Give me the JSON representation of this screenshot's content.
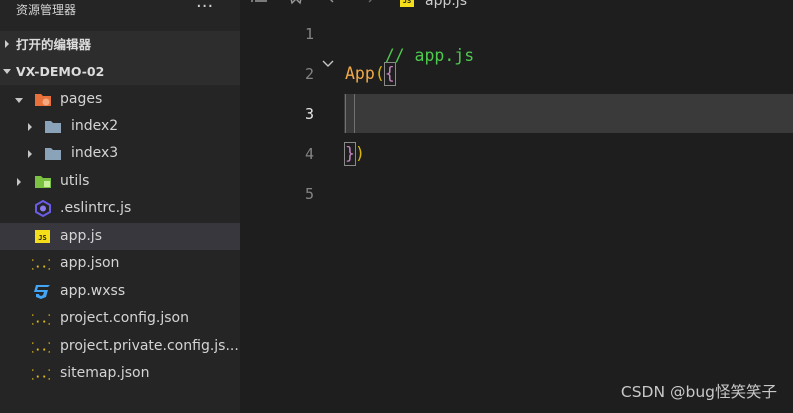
{
  "sidebar": {
    "title": "资源管理器",
    "more_label": "···",
    "sections": [
      {
        "label": "打开的编辑器"
      },
      {
        "label": "VX-DEMO-02"
      }
    ],
    "items": [
      {
        "label": "pages",
        "icon": "folder-pages-icon"
      },
      {
        "label": "index2",
        "icon": "folder-icon"
      },
      {
        "label": "index3",
        "icon": "folder-icon"
      },
      {
        "label": "utils",
        "icon": "folder-utils-icon"
      },
      {
        "label": ".eslintrc.js",
        "icon": "eslint-icon"
      },
      {
        "label": "app.js",
        "icon": "javascript-icon"
      },
      {
        "label": "app.json",
        "icon": "json-icon"
      },
      {
        "label": "app.wxss",
        "icon": "css-icon"
      },
      {
        "label": "project.config.json",
        "icon": "json-icon"
      },
      {
        "label": "project.private.config.js...",
        "icon": "json-icon"
      },
      {
        "label": "sitemap.json",
        "icon": "json-icon"
      }
    ]
  },
  "editor": {
    "breadcrumb": "app.js",
    "js_badge": "JS",
    "line_numbers": [
      "1",
      "2",
      "3",
      "4",
      "5"
    ],
    "active_line": "3",
    "code": {
      "line1": "// app.js",
      "line2_fn": "App",
      "line2_paren": "(",
      "line2_brace": "{",
      "line4_brace": "}",
      "line4_paren": ")"
    }
  },
  "watermark": "CSDN @bug怪笑笑子",
  "colors": {
    "sidebar_bg": "#252526",
    "editor_bg": "#1e1e1e",
    "selected_row": "#37373d",
    "comment": "#4ec94e",
    "function": "#f0a94a",
    "brace": "#c586c0",
    "paren": "#d9b40a"
  }
}
